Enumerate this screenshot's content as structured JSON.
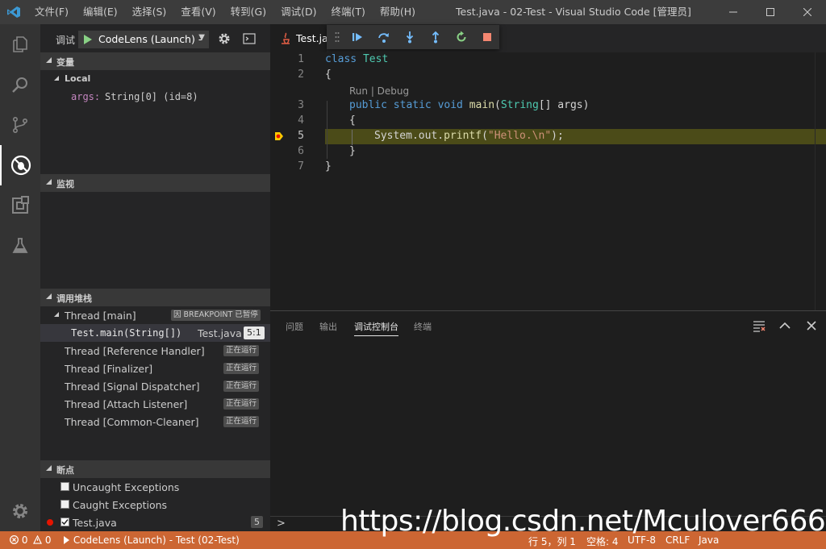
{
  "titlebar": {
    "menu": [
      "文件(F)",
      "编辑(E)",
      "选择(S)",
      "查看(V)",
      "转到(G)",
      "调试(D)",
      "终端(T)",
      "帮助(H)"
    ],
    "title": "Test.java - 02-Test - Visual Studio Code [管理员]"
  },
  "activity": [
    "explorer-icon",
    "search-icon",
    "source-control-icon",
    "debug-icon",
    "extensions-icon",
    "test-icon",
    "settings-gear-icon"
  ],
  "sidebar": {
    "debug_label": "调试",
    "config": "CodeLens (Launch) -",
    "variables": {
      "header": "变量",
      "local_label": "Local",
      "arg_name": "args:",
      "arg_value": "String[0] (id=8)"
    },
    "watch": {
      "header": "监视"
    },
    "callstack": {
      "header": "调用堆栈",
      "main_thread": "Thread [main]",
      "main_badge": "因 BREAKPOINT 已暂停",
      "frame_name": "Test.main(String[])",
      "frame_file": "Test.java",
      "frame_pos": "5:1",
      "threads": [
        {
          "name": "Thread [Reference Handler]",
          "status": "正在运行"
        },
        {
          "name": "Thread [Finalizer]",
          "status": "正在运行"
        },
        {
          "name": "Thread [Signal Dispatcher]",
          "status": "正在运行"
        },
        {
          "name": "Thread [Attach Listener]",
          "status": "正在运行"
        },
        {
          "name": "Thread [Common-Cleaner]",
          "status": "正在运行"
        }
      ]
    },
    "breakpoints": {
      "header": "断点",
      "items": [
        {
          "label": "Uncaught Exceptions"
        },
        {
          "label": "Caught Exceptions"
        },
        {
          "label": "Test.java",
          "count": "5"
        }
      ]
    }
  },
  "editor": {
    "tab_label": "Test.java",
    "codelens": "Run | Debug",
    "line_numbers": [
      "1",
      "2",
      "3",
      "4",
      "5",
      "6",
      "7"
    ],
    "code": {
      "l1_kw": "class",
      "l1_name": "Test",
      "l2": "{",
      "l3_mod": "public static void",
      "l3_fn": "main",
      "l3_type": "String",
      "l3_rest": "[] args)",
      "l4": "{",
      "l5_pre": "System.out.",
      "l5_fn": "printf",
      "l5_str": "\"Hello.\\n\"",
      "l5_end": ");",
      "l6": "}",
      "l7": "}"
    }
  },
  "panel": {
    "tabs": [
      "问题",
      "输出",
      "调试控制台",
      "终端"
    ],
    "prompt": ">"
  },
  "statusbar": {
    "errors": "0",
    "warnings": "0",
    "launch": "CodeLens (Launch) - Test (02-Test)",
    "position": "行 5，列 1",
    "spaces": "空格: 4",
    "encoding": "UTF-8",
    "eol": "CRLF",
    "language": "Java"
  },
  "watermark": "https://blog.csdn.net/Mculover666",
  "colors": {
    "status_bg": "#cc6633",
    "accent": "#007acc",
    "highlight": "#4b4b18"
  }
}
